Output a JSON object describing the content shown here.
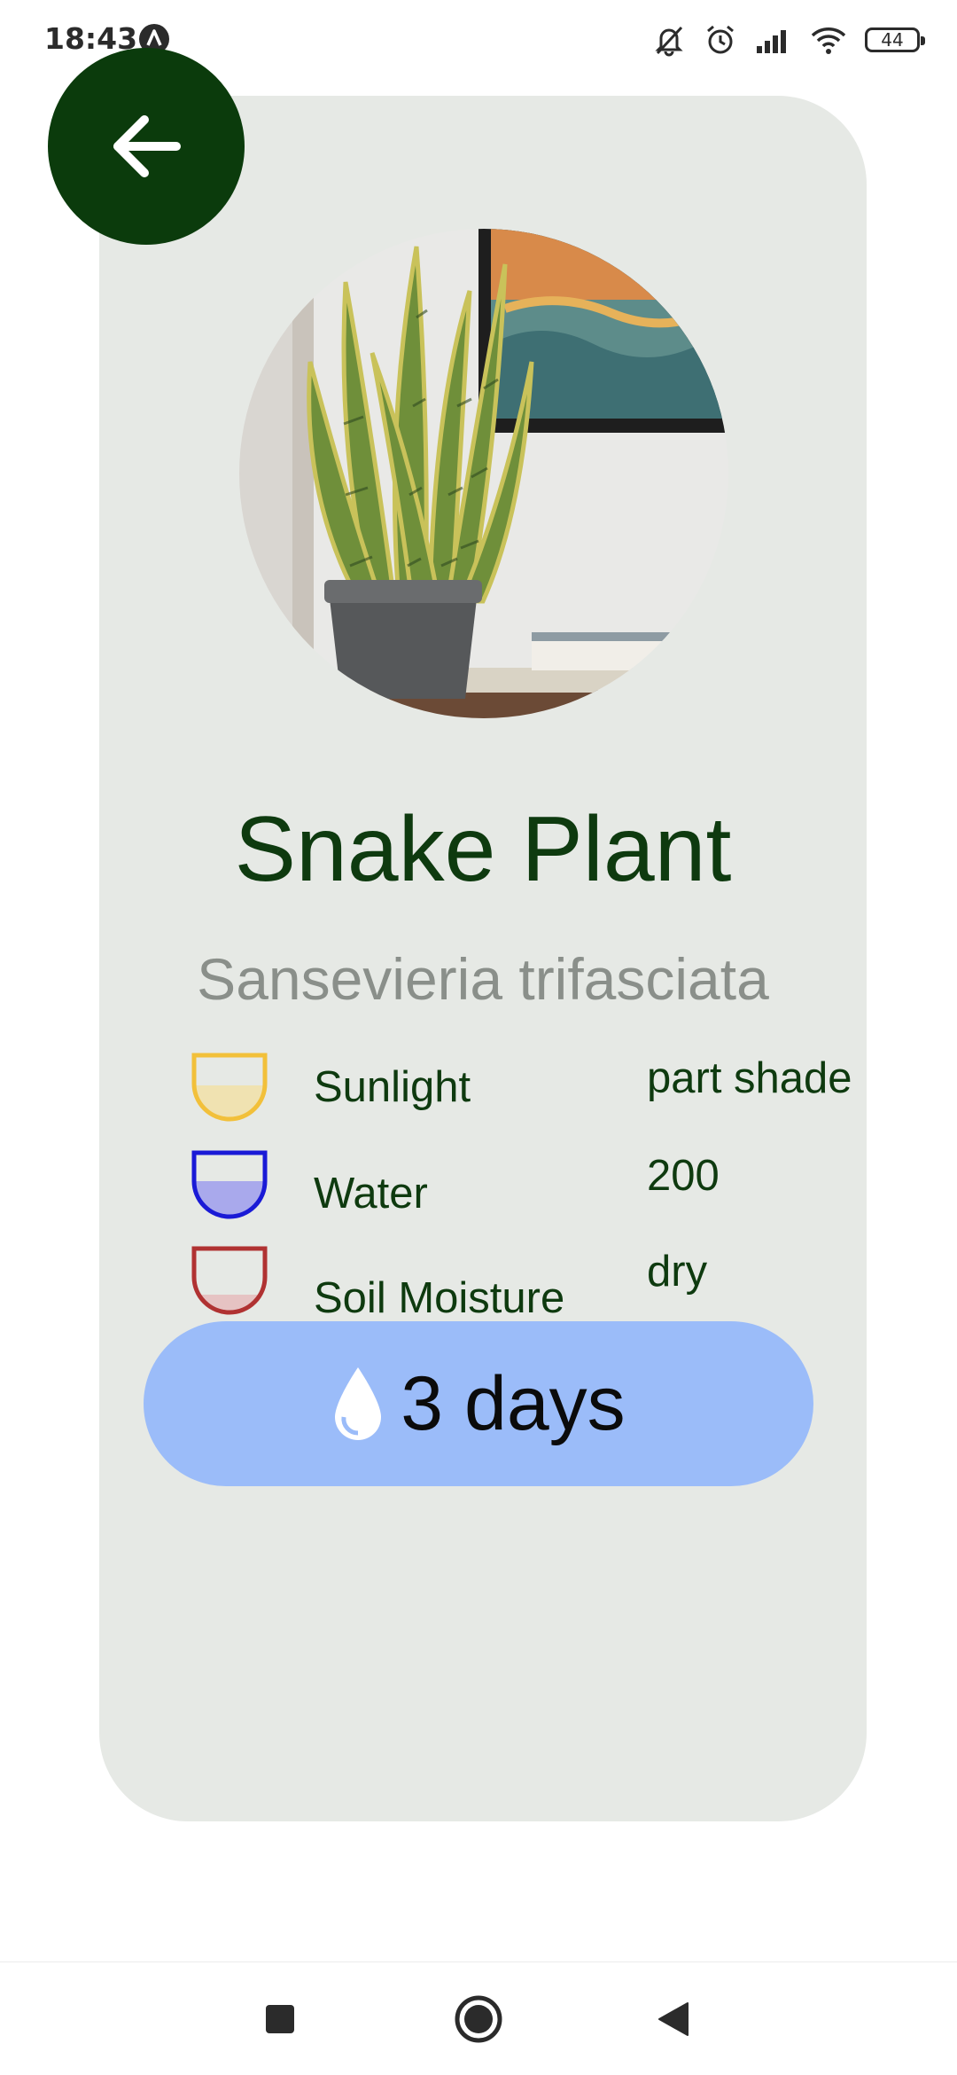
{
  "status_bar": {
    "time": "18:43",
    "battery_level": "44",
    "icons": [
      "app-notification-icon",
      "mute-icon",
      "alarm-icon",
      "signal-icon",
      "wifi-icon",
      "battery-icon"
    ]
  },
  "header": {
    "back_icon": "arrow-left-icon",
    "back_color": "#0b3b0c"
  },
  "plant": {
    "name": "Snake Plant",
    "scientific_name": "Sansevieria trifasciata",
    "image_icon": "plant-photo",
    "care": [
      {
        "label": "Sunlight",
        "value": "part shade",
        "icon": "sunlight-cup-icon",
        "color": "#f2c03a",
        "fill_fraction": 0.5
      },
      {
        "label": "Water",
        "value": "200",
        "icon": "water-cup-icon",
        "color": "#1a1ad6",
        "fill_fraction": 0.5
      },
      {
        "label": "Soil Moisture",
        "value": "dry",
        "icon": "soil-cup-icon",
        "color": "#b03232",
        "fill_fraction": 0.2
      }
    ],
    "watering": {
      "text": "3 days",
      "icon": "water-drop-icon",
      "color": "#9bbcf9"
    }
  },
  "navigation": {
    "buttons": [
      "recents-square-icon",
      "home-circle-icon",
      "back-triangle-icon"
    ]
  },
  "colors": {
    "card_background": "#e6e9e5",
    "heading_green": "#0e3a0f",
    "subtitle_gray": "#8a8f8a"
  }
}
